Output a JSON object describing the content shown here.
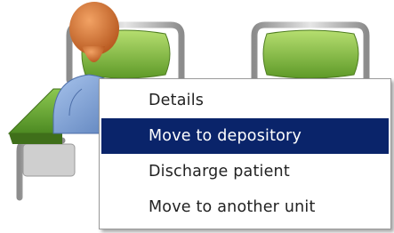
{
  "context_menu": {
    "items": [
      {
        "label": "Details",
        "selected": false
      },
      {
        "label": "Move to depository",
        "selected": true
      },
      {
        "label": "Discharge patient",
        "selected": false
      },
      {
        "label": "Move to another unit",
        "selected": false
      }
    ],
    "highlight_color": "#0a246a"
  },
  "scene": {
    "icons": [
      "hospital-bed-icon",
      "patient-icon",
      "hospital-bed-icon"
    ],
    "colors": {
      "bed_frame": "#b8b8b8",
      "pillow": "#8fc24a",
      "sheet": "#6aa83a",
      "patient_head": "#d9773a",
      "patient_shirt": "#7fa3d8"
    }
  }
}
